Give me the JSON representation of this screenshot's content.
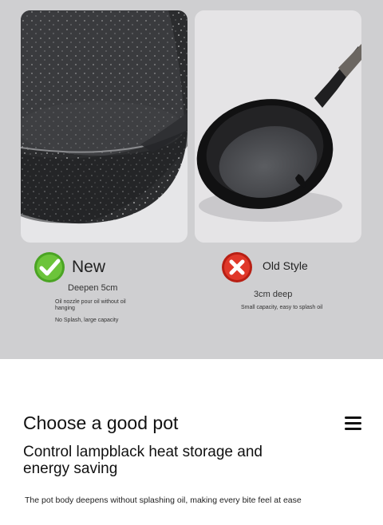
{
  "comparison": {
    "new": {
      "title": "New",
      "feature": "Deepen 5cm",
      "note_1": "Oil nozzle pour oil without oil hanging",
      "note_2": "No Splash, large capacity",
      "icon": "check-icon",
      "accent": "#5fb82e"
    },
    "old": {
      "title": "Old Style",
      "feature": "3cm deep",
      "note_1": "Small capacity, easy to splash oil",
      "icon": "close-icon",
      "accent": "#d52b1e"
    }
  },
  "headline": "Choose a good pot",
  "subheadline": "Control lampblack heat storage and energy saving",
  "body": "The pot body deepens without splashing oil, making every bite feel at ease",
  "colors": {
    "panel_background": "#cfcfd1",
    "pot_color": "#2e2f31"
  }
}
